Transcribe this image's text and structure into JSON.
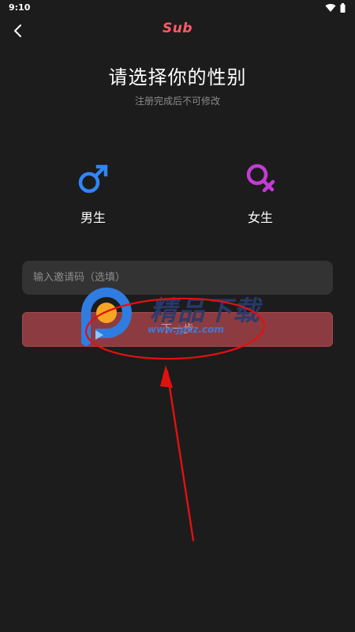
{
  "status_bar": {
    "time": "9:10",
    "icons": [
      "wifi-icon",
      "battery-icon"
    ]
  },
  "app_bar": {
    "back_icon": "chevron-left-icon",
    "logo_text": "Sub"
  },
  "page": {
    "title": "请选择你的性别",
    "subtitle": "注册完成后不可修改"
  },
  "genders": [
    {
      "label": "男生",
      "icon": "male-symbol-icon",
      "color": "#2f86f6"
    },
    {
      "label": "女生",
      "icon": "female-symbol-icon",
      "color": "#c43bd6"
    }
  ],
  "invite": {
    "placeholder": "输入邀请码（选填）",
    "value": ""
  },
  "next_button": {
    "label": "下一步"
  },
  "watermark": {
    "text": "精品下载",
    "url": "www.jpxz.com"
  },
  "colors": {
    "background": "#1c1c1c",
    "accent": "#ff5b66",
    "button": "#8c3c40",
    "input": "#333333",
    "annotation": "#e31010"
  }
}
